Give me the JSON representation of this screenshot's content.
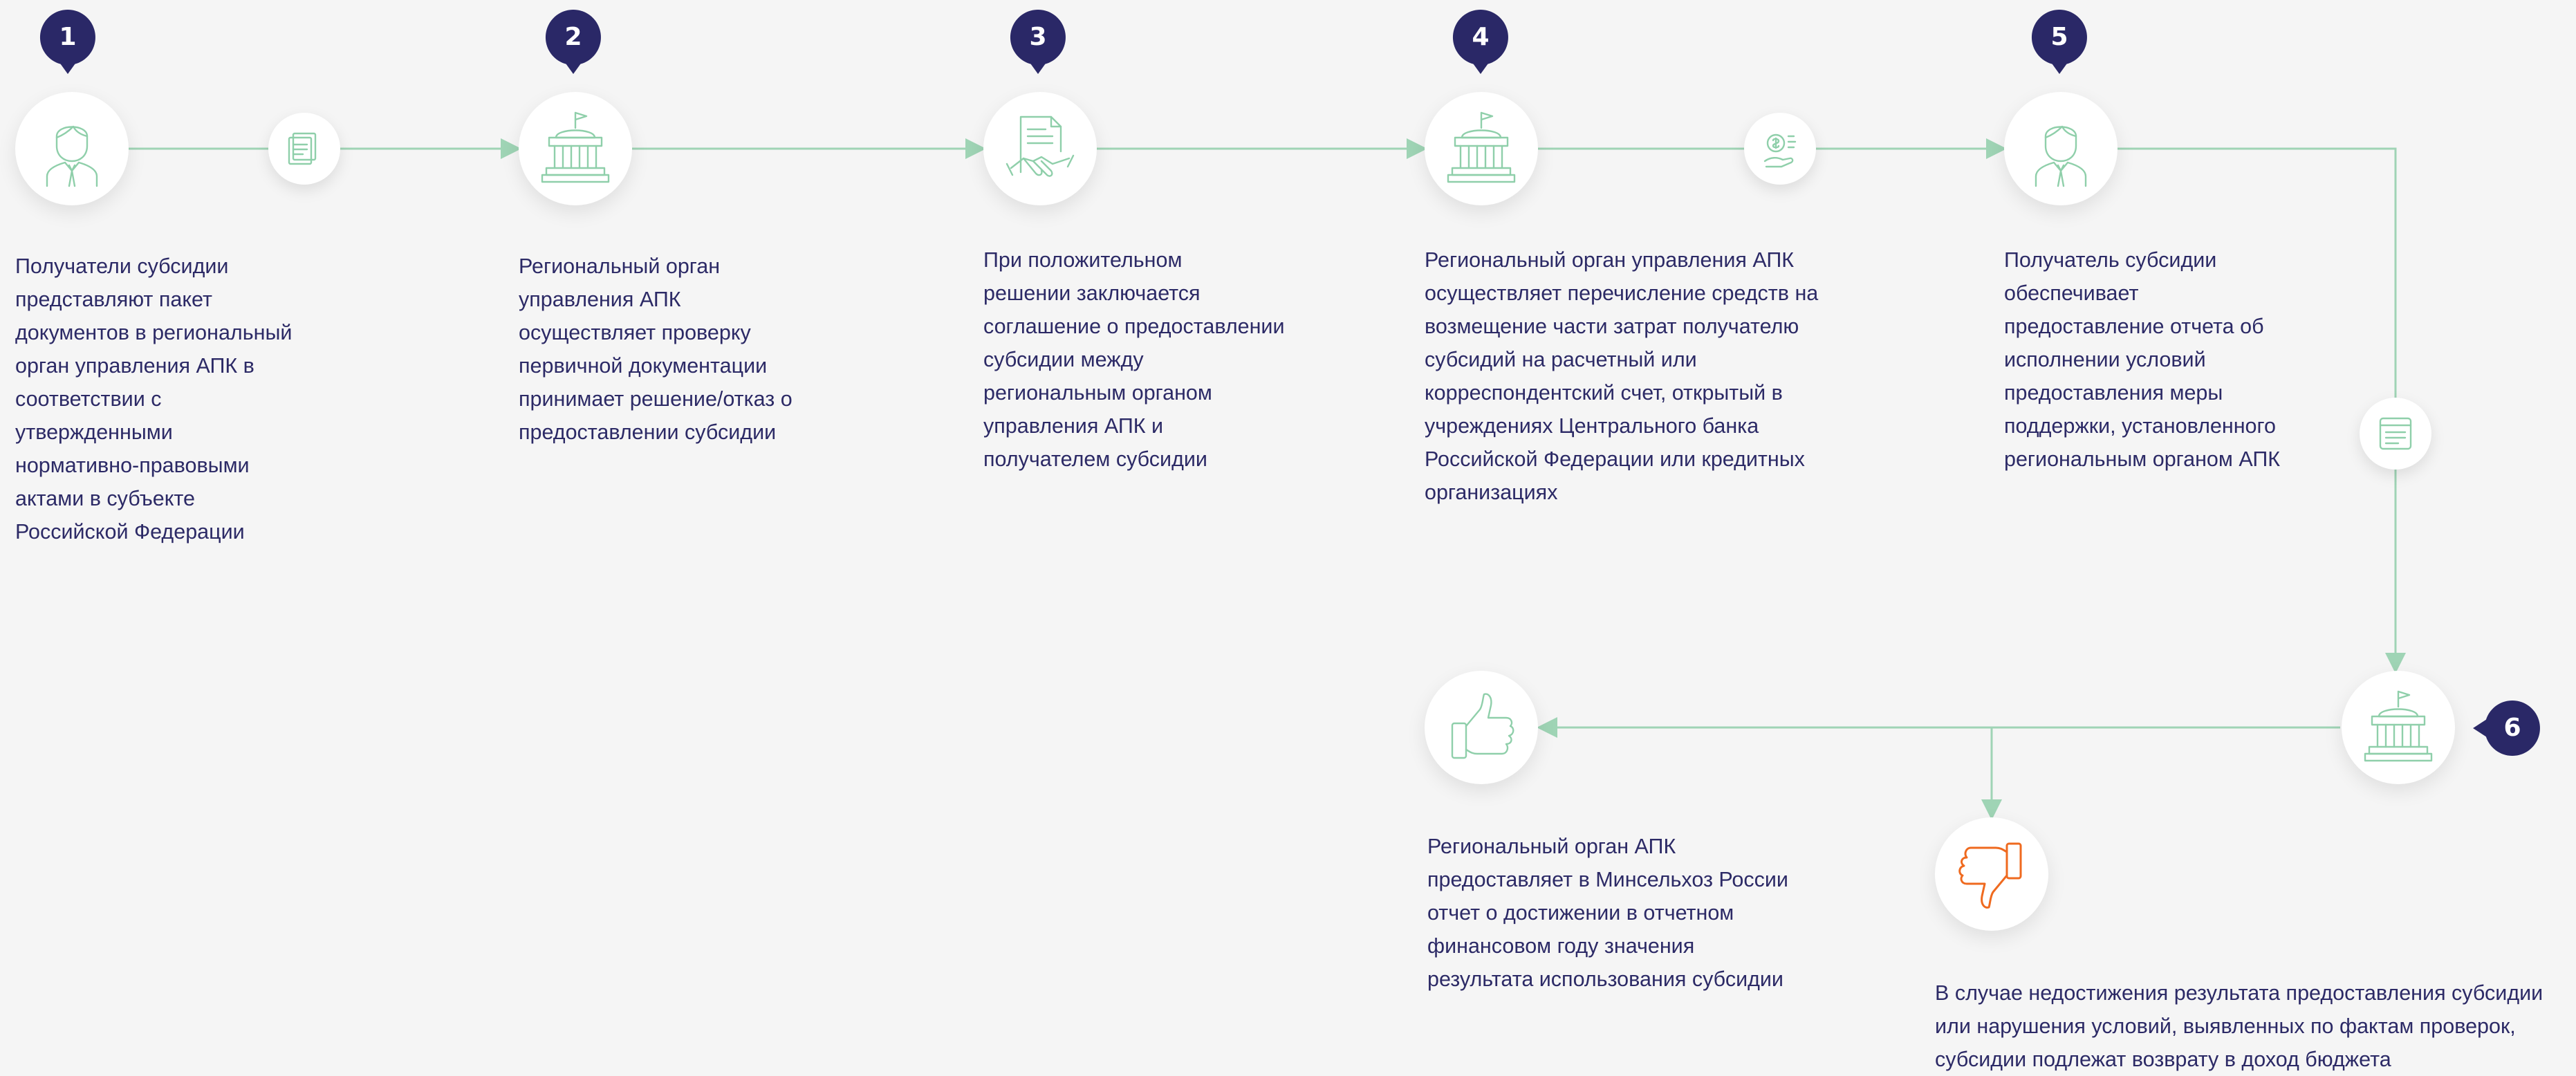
{
  "colors": {
    "background": "#f5f5f5",
    "connector": "#9fd4b5",
    "icon": "#8fcfaa",
    "marker": "#2a2867",
    "text": "#2c2a66",
    "negative": "#ef6a1f"
  },
  "steps": [
    {
      "number": "1",
      "icon": "person-icon",
      "text": "Получатели субсидии\nпредставляют пакет\nдокументов в региональный\nорган управления АПК в\nсоответствии с\nутвержденными\nнормативно-правовыми\nактами в субъекте\nРоссийской Федерации"
    },
    {
      "number": "2",
      "icon": "government-building-icon",
      "text": "Региональный орган\nуправления АПК\nосуществляет проверку\nпервичной документации\nпринимает решение/отказ о\nпредоставлении субсидии"
    },
    {
      "number": "3",
      "icon": "agreement-handshake-icon",
      "text": "При положительном\nрешении заключается\nсоглашение о предоставлении\nсубсидии между\nрегиональным органом\nуправления АПК и\nполучателем субсидии"
    },
    {
      "number": "4",
      "icon": "government-building-icon",
      "text": "Региональный орган управления АПК\nосуществляет перечисление средств на\nвозмещение части затрат получателю\nсубсидий на расчетный или\nкорреспондентский счет, открытый в\nучреждениях Центрального банка\nРоссийской Федерации или кредитных\nорганизациях"
    },
    {
      "number": "5",
      "icon": "person-icon",
      "text": "Получатель субсидии\nобеспечивает\nпредоставление отчета об\nисполнении условий\nпредоставления меры\nподдержки, установленного\nрегиональным органом АПК"
    },
    {
      "number": "6",
      "icon": "government-building-icon",
      "text": ""
    }
  ],
  "connector_icons": [
    "documents-icon",
    "money-transfer-icon",
    "report-icon"
  ],
  "outcomes": {
    "positive": {
      "icon": "thumbs-up-icon",
      "text": "Региональный орган АПК\nпредоставляет в Минсельхоз России\nотчет о  достижении в отчетном\nфинансовом году значения\nрезультата использования субсидии"
    },
    "negative": {
      "icon": "thumbs-down-icon",
      "text": "В случае недостижения результата предоставления субсидии\nили нарушения условий, выявленных по фактам проверок,\nсубсидии подлежат возврату в доход бюджета"
    }
  }
}
